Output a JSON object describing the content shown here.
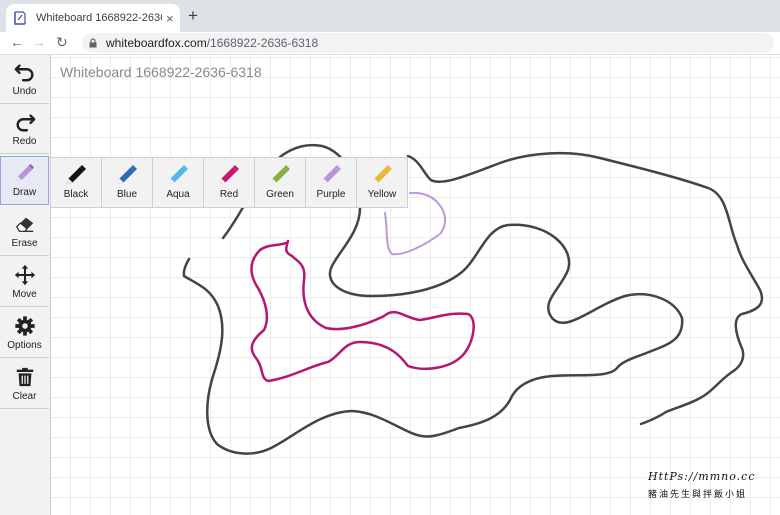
{
  "browser": {
    "tab_title": "Whiteboard 1668922-2636-6318",
    "close_glyph": "×",
    "newtab_glyph": "+",
    "back_glyph": "←",
    "forward_glyph": "→",
    "reload_glyph": "↻",
    "url_host": "whiteboardfox.com",
    "url_path": "/1668922-2636-6318",
    "icons": [
      "whiteboard-favicon",
      "lock-icon"
    ]
  },
  "board": {
    "title": "Whiteboard 1668922-2636-6318",
    "grid": true
  },
  "tools": [
    {
      "label": "Undo",
      "icon": "undo-icon"
    },
    {
      "label": "Redo",
      "icon": "redo-icon"
    },
    {
      "label": "Draw",
      "icon": "pencil-icon",
      "active": true
    },
    {
      "label": "Erase",
      "icon": "eraser-icon"
    },
    {
      "label": "Move",
      "icon": "move-icon"
    },
    {
      "label": "Options",
      "icon": "gear-icon"
    },
    {
      "label": "Clear",
      "icon": "trash-icon"
    }
  ],
  "palette": [
    {
      "label": "Black",
      "color": "#111111"
    },
    {
      "label": "Blue",
      "color": "#2f6bb5"
    },
    {
      "label": "Aqua",
      "color": "#4fb8e8"
    },
    {
      "label": "Red",
      "color": "#c9196e"
    },
    {
      "label": "Green",
      "color": "#85b23a"
    },
    {
      "label": "Purple",
      "color": "#b794de"
    },
    {
      "label": "Yellow",
      "color": "#e8b83a"
    }
  ],
  "strokes": {
    "gray": "#444444",
    "magenta": "#b5166f",
    "purple": "#b99ad8"
  },
  "watermark": {
    "url": "HttPs://mmno.cc",
    "name": "豬油先生與拌飯小姐"
  }
}
